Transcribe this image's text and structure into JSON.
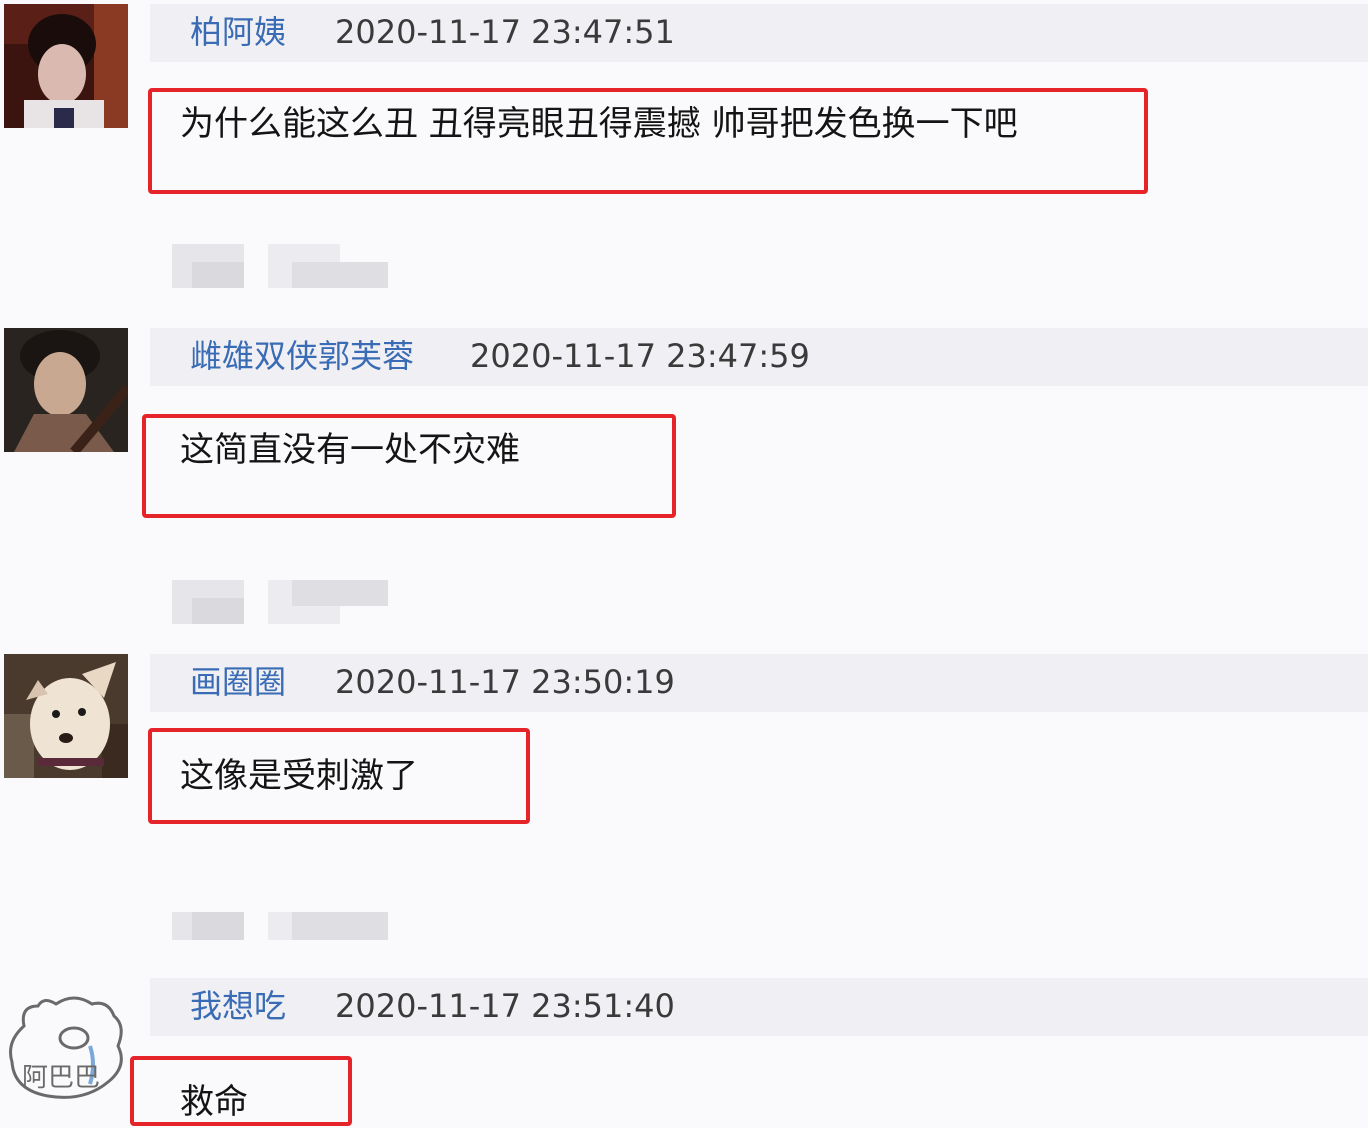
{
  "comments": [
    {
      "username": "柏阿姨",
      "timestamp": "2020-11-17 23:47:51",
      "text": "为什么能这么丑 丑得亮眼丑得震撼 帅哥把发色换一下吧",
      "avatar": "photo-woman-icon"
    },
    {
      "username": "雌雄双侠郭芙蓉",
      "timestamp": "2020-11-17 23:47:59",
      "text": "这简直没有一处不灾难",
      "avatar": "photo-actress-icon"
    },
    {
      "username": "画圈圈",
      "timestamp": "2020-11-17 23:50:19",
      "text": "这像是受刺激了",
      "avatar": "photo-dog-icon"
    },
    {
      "username": "我想吃",
      "timestamp": "2020-11-17 23:51:40",
      "text": "救命",
      "avatar": "sketch-bear-icon",
      "avatar_caption": "阿巴巴"
    }
  ],
  "colors": {
    "username": "#3a6bb5",
    "highlight_border": "#e5242a",
    "header_bar": "#f0f0f4"
  }
}
